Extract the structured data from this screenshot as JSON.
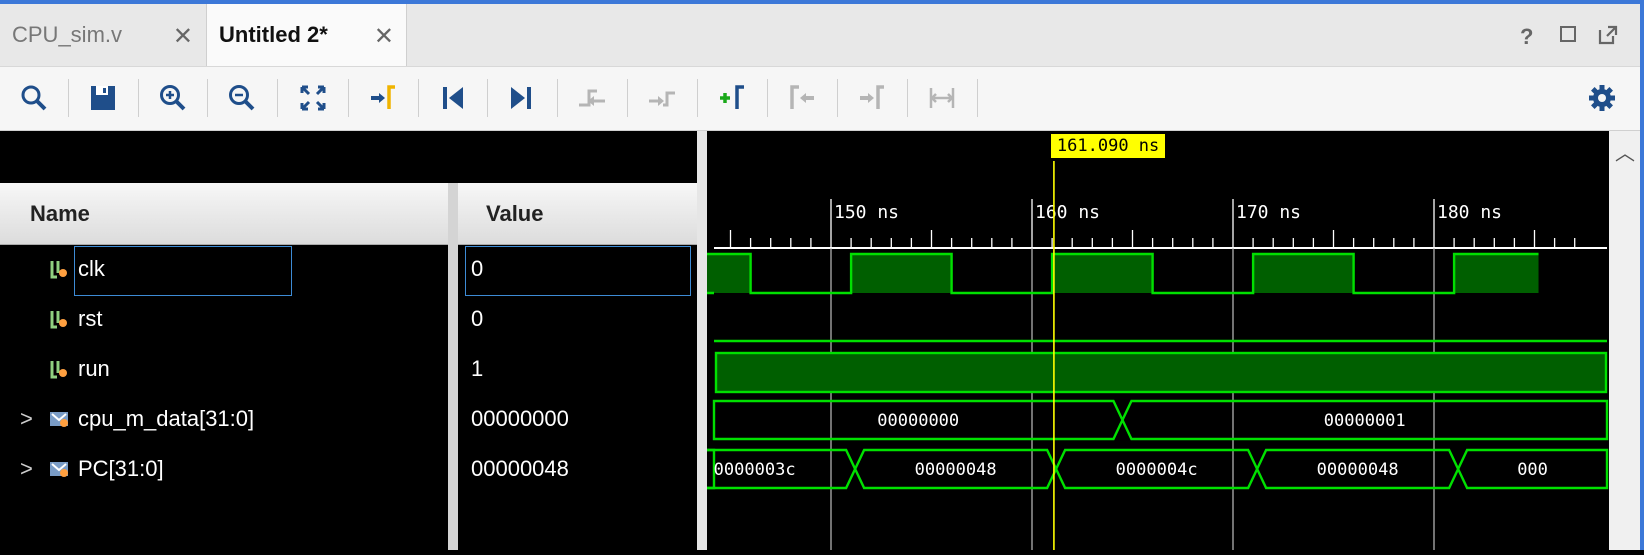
{
  "tabs": [
    {
      "label": "CPU_sim.v",
      "active": false
    },
    {
      "label": "Untitled 2*",
      "active": true
    }
  ],
  "tab_controls": {
    "help": "?",
    "maximize_icon": "maximize-icon",
    "restore_icon": "float-icon"
  },
  "toolbar": {
    "buttons": [
      "search-icon",
      "save-icon",
      "zoom-in-icon",
      "zoom-out-icon",
      "zoom-fit-icon",
      "go-to-cursor-icon",
      "go-to-time-zero-icon",
      "go-to-last-time-icon",
      "previous-transition-icon",
      "next-transition-icon",
      "add-marker-icon",
      "previous-marker-icon",
      "next-marker-icon",
      "swap-cursors-icon",
      "settings-icon"
    ]
  },
  "columns": {
    "name": "Name",
    "value": "Value"
  },
  "signals": [
    {
      "name": "clk",
      "value": "0",
      "type": "bit",
      "expandable": false,
      "selected": true
    },
    {
      "name": "rst",
      "value": "0",
      "type": "bit",
      "expandable": false,
      "selected": false
    },
    {
      "name": "run",
      "value": "1",
      "type": "bit",
      "expandable": false,
      "selected": false
    },
    {
      "name": "cpu_m_data[31:0]",
      "value": "00000000",
      "type": "bus",
      "expandable": true,
      "selected": false
    },
    {
      "name": "PC[31:0]",
      "value": "00000048",
      "type": "bus",
      "expandable": true,
      "selected": false
    }
  ],
  "expander_glyph": ">",
  "waveform": {
    "cursor_label": "161.090 ns",
    "cursor_time_ns": 161.09,
    "time_labels": [
      "150 ns",
      "160 ns",
      "170 ns",
      "180 ns"
    ],
    "bus_values": {
      "cpu_m_data": [
        "00000000",
        "00000001"
      ],
      "pc": [
        "0000003c",
        "00000048",
        "0000004c",
        "00000048",
        "000"
      ]
    },
    "colors": {
      "wave": "#00e000",
      "fill": "#005f00",
      "cursor": "#ffff00",
      "grid": "#bfbfbf"
    }
  }
}
